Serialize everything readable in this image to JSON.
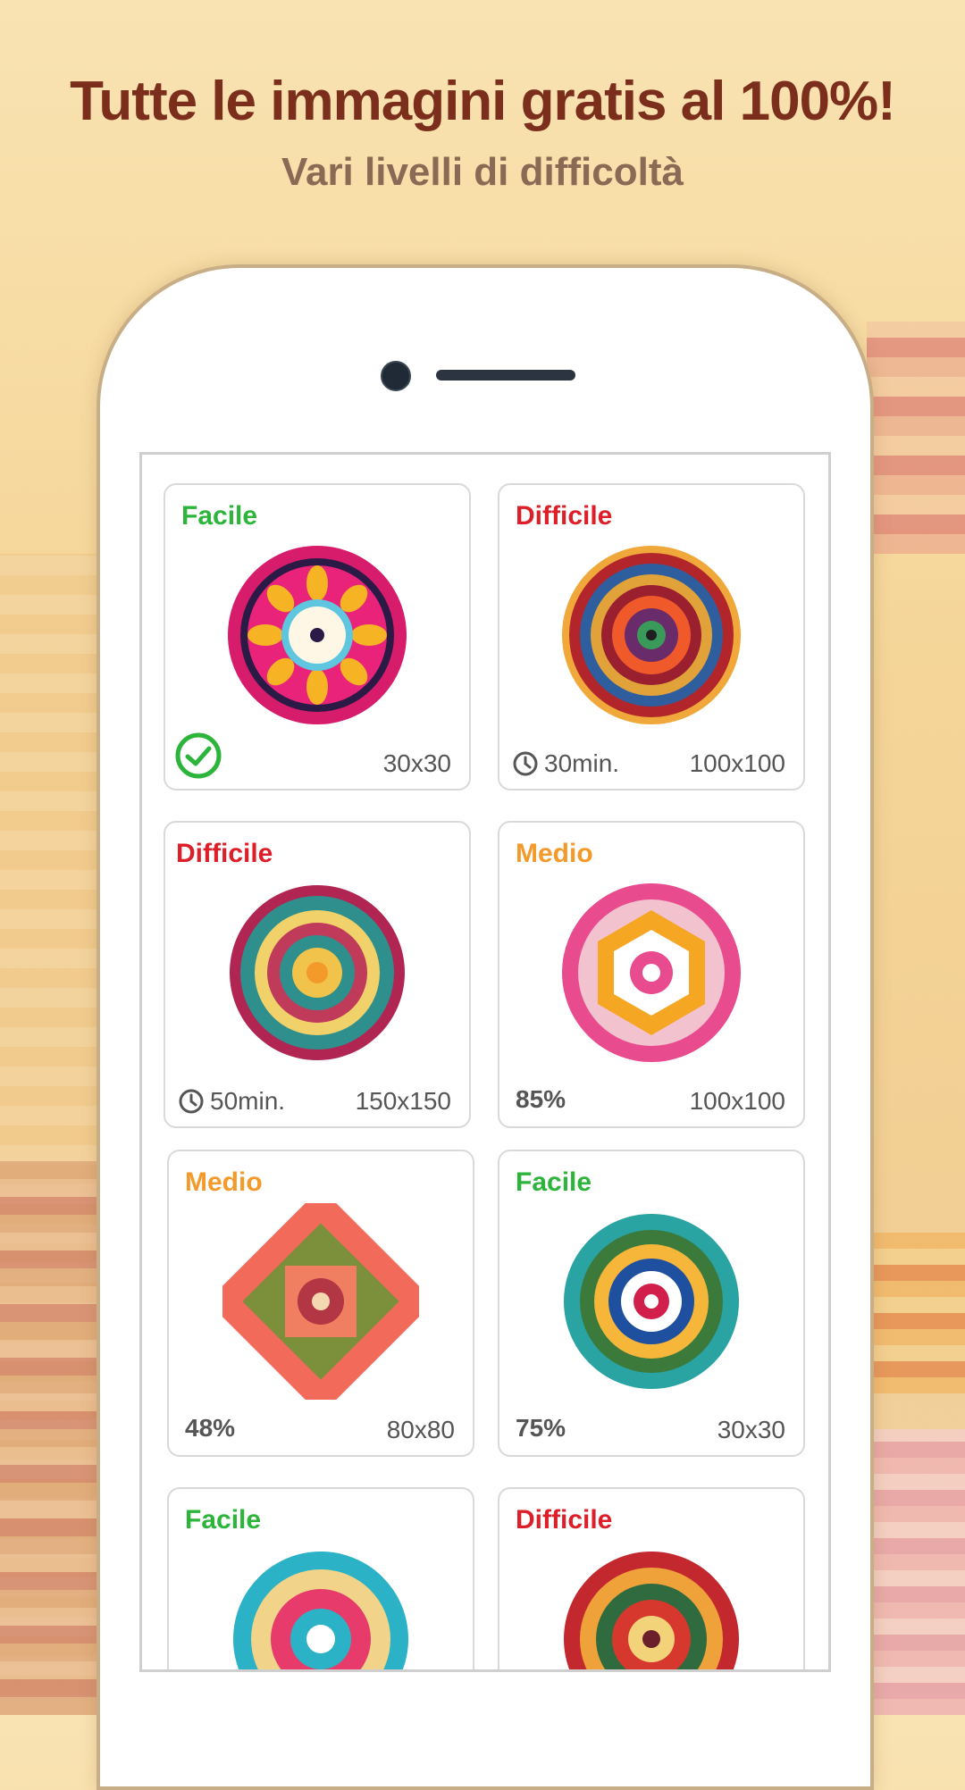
{
  "header": {
    "title": "Tutte le immagini gratis al 100%!",
    "subtitle": "Vari livelli di difficoltà"
  },
  "cards": [
    {
      "level": "Facile",
      "size": "30x30",
      "status": "completed",
      "accent": "#2cb53a",
      "icon": "check-circle-icon"
    },
    {
      "level": "Difficile",
      "size": "100x100",
      "time": "30min.",
      "accent": "#dd1f2a",
      "icon": "clock-icon"
    },
    {
      "level": "Difficile",
      "size": "150x150",
      "time": "50min.",
      "accent": "#dd1f2a",
      "icon": "clock-icon"
    },
    {
      "level": "Medio",
      "size": "100x100",
      "progress": "85%",
      "accent": "#f39a2a"
    },
    {
      "level": "Medio",
      "size": "80x80",
      "progress": "48%",
      "accent": "#f39a2a"
    },
    {
      "level": "Facile",
      "size": "30x30",
      "progress": "75%",
      "accent": "#2cb53a"
    },
    {
      "level": "Facile",
      "accent": "#2cb53a"
    },
    {
      "level": "Difficile",
      "accent": "#dd1f2a"
    }
  ]
}
